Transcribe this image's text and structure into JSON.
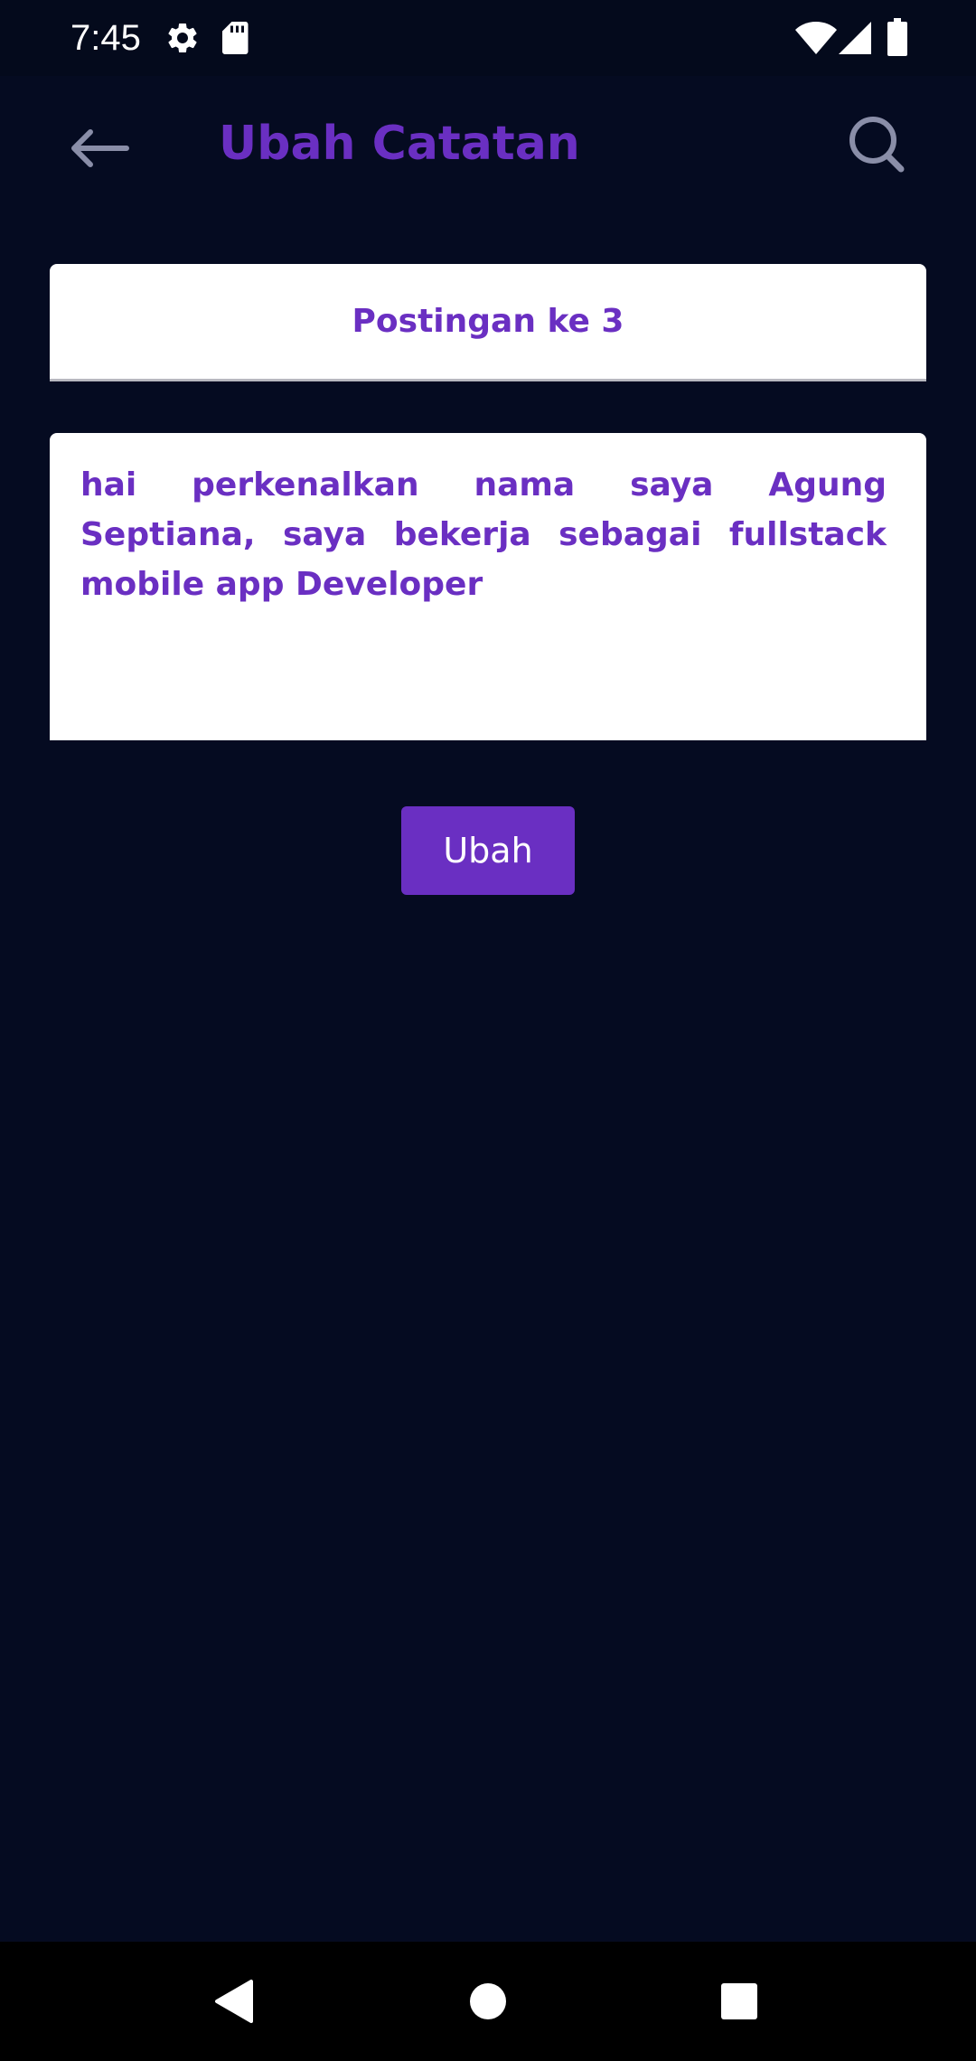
{
  "status_bar": {
    "time": "7:45",
    "left_icons": [
      "settings-icon",
      "sd-card-icon"
    ],
    "right_icons": [
      "wifi-icon",
      "signal-icon",
      "battery-icon"
    ]
  },
  "app_bar": {
    "title": "Ubah Catatan",
    "back_icon": "arrow-left-icon",
    "search_icon": "search-icon"
  },
  "form": {
    "title_value": "Postingan ke 3",
    "body_value": "hai perkenalkan nama saya Agung Septiana, saya bekerja sebagai fullstack mobile app Developer",
    "submit_label": "Ubah"
  },
  "nav_bar": {
    "buttons": [
      "back-triangle-icon",
      "home-circle-icon",
      "recents-square-icon"
    ]
  },
  "colors": {
    "background": "#050b21",
    "accent": "#6a2fc2",
    "field_background": "#ffffff",
    "nav_background": "#000000"
  }
}
